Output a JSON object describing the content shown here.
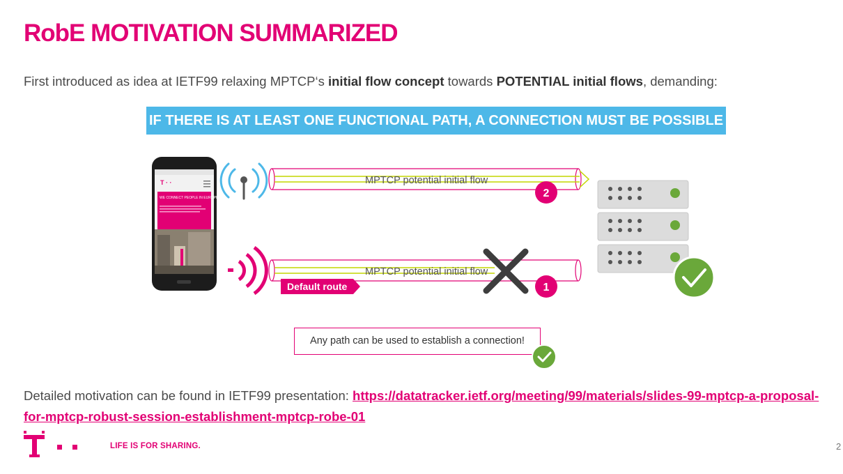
{
  "slide": {
    "title": "RobE MOTIVATION SUMMARIZED",
    "intro": {
      "part1": "First introduced as idea at IETF99 relaxing MPTCP‘s ",
      "bold1": "initial flow concept",
      "part2": " towards ",
      "bold2": "POTENTIAL initial flows",
      "part3": ", demanding:"
    },
    "banner": "IF THERE IS AT LEAST ONE FUNCTIONAL PATH, A CONNECTION MUST BE POSSIBLE",
    "diagram": {
      "flow_top_label": "MPTCP potential initial flow",
      "flow_top_number": "2",
      "flow_bottom_label": "MPTCP potential initial flow",
      "flow_bottom_number": "1",
      "default_route_label": "Default route",
      "phone_screen_heading": "WE CONNECT PEOPLE IN EUROPE",
      "icons": [
        "smartphone-icon",
        "wifi-antenna-icon",
        "cellular-signal-icon",
        "server-rack-icon",
        "check-icon",
        "cross-icon"
      ]
    },
    "callout": "Any path can be used to establish a connection!",
    "detail": {
      "text": "Detailed motivation can be found in IETF99 presentation: ",
      "link": "https://datatracker.ietf.org/meeting/99/materials/slides-99-mptcp-a-proposal-for-mptcp-robust-session-establishment-mptcp-robe-01"
    },
    "footer": {
      "slogan": "LIFE IS FOR SHARING.",
      "page_number": "2"
    },
    "colors": {
      "magenta": "#e20074",
      "banner_blue": "#4db8e8",
      "flow_green": "#c4d600",
      "check_green": "#6aa83a"
    }
  }
}
